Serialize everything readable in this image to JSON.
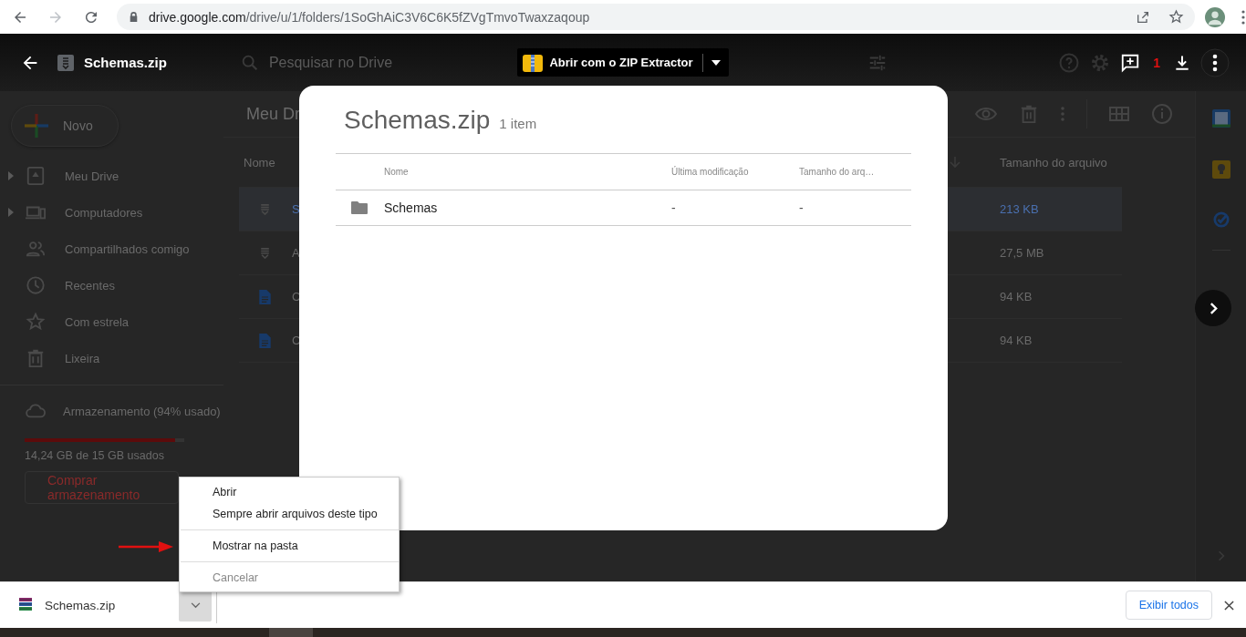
{
  "browser": {
    "url_domain": "drive.google.com",
    "url_path": "/drive/u/1/folders/1SoGhAiC3V6C6K5fZVgTmvoTwaxzaqoup"
  },
  "preview_header": {
    "file_name": "Schemas.zip",
    "search_placeholder": "Pesquisar no Drive",
    "open_with": "Abrir com o ZIP Extractor",
    "comment_count": "1"
  },
  "sidebar": {
    "new_button": "Novo",
    "items": [
      {
        "label": "Meu Drive",
        "expandable": true
      },
      {
        "label": "Computadores",
        "expandable": true
      },
      {
        "label": "Compartilhados comigo",
        "expandable": false
      },
      {
        "label": "Recentes",
        "expandable": false
      },
      {
        "label": "Com estrela",
        "expandable": false
      },
      {
        "label": "Lixeira",
        "expandable": false
      }
    ],
    "storage": {
      "label": "Armazenamento (94% usado)",
      "level": 0.94,
      "usage": "14,24 GB de 15 GB usados",
      "buy_button": "Comprar armazenamento"
    }
  },
  "file_list": {
    "title": "Meu Dr",
    "columns": [
      "Nome",
      "Tamanho do arquivo"
    ],
    "rows": [
      {
        "name": "S",
        "size": "213 KB",
        "kind": "zip",
        "selected": true
      },
      {
        "name": "A",
        "size": "27,5 MB",
        "kind": "zip",
        "selected": false
      },
      {
        "name": "C",
        "size": "94 KB",
        "kind": "doc",
        "selected": false
      },
      {
        "name": "C",
        "size": "94 KB",
        "kind": "doc",
        "selected": false
      }
    ]
  },
  "archive_dialog": {
    "title": "Schemas.zip",
    "count": "1 item",
    "columns": [
      "Nome",
      "Última modificação",
      "Tamanho do arq…"
    ],
    "rows": [
      {
        "name": "Schemas",
        "modified": "-",
        "size": "-",
        "kind": "folder"
      }
    ]
  },
  "context_menu": {
    "items": [
      {
        "kind": "item",
        "label": "Abrir",
        "disabled": false
      },
      {
        "kind": "item",
        "label": "Sempre abrir arquivos deste tipo",
        "disabled": false
      },
      {
        "kind": "separator"
      },
      {
        "kind": "item",
        "label": "Mostrar na pasta",
        "disabled": false
      },
      {
        "kind": "separator"
      },
      {
        "kind": "item",
        "label": "Cancelar",
        "disabled": true
      }
    ]
  },
  "download_bar": {
    "file_name": "Schemas.zip",
    "show_all": "Exibir todos"
  }
}
